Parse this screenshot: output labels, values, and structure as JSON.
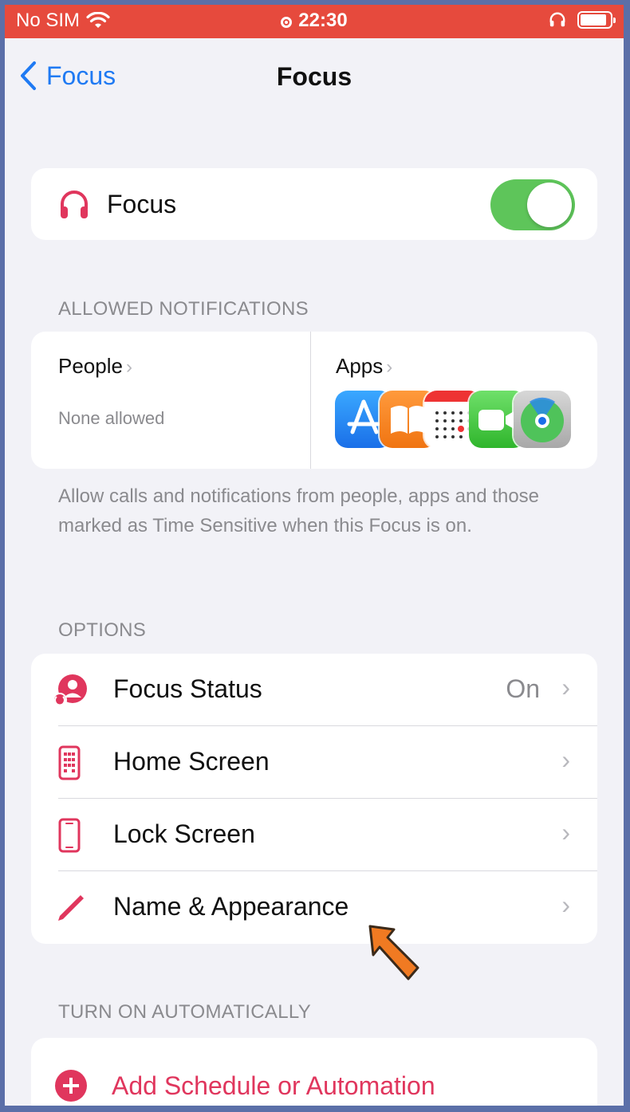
{
  "status_bar": {
    "carrier": "No SIM",
    "time": "22:30",
    "bar_color": "#e64a3d"
  },
  "nav": {
    "back_label": "Focus",
    "title": "Focus"
  },
  "focus_toggle": {
    "label": "Focus",
    "icon": "headphones-icon",
    "state": "on"
  },
  "allowed_notifications": {
    "header": "ALLOWED NOTIFICATIONS",
    "people_title": "People",
    "people_sub": "None allowed",
    "apps_title": "Apps",
    "apps": [
      "app-store-icon",
      "books-icon",
      "calendar-icon",
      "facetime-icon",
      "find-my-icon"
    ]
  },
  "description": "Allow calls and notifications from people, apps and those marked as Time Sensitive when this Focus is on.",
  "options": {
    "header": "OPTIONS",
    "rows": [
      {
        "label": "Focus Status",
        "value": "On",
        "icon": "focus-status-icon"
      },
      {
        "label": "Home Screen",
        "value": "",
        "icon": "home-screen-icon"
      },
      {
        "label": "Lock Screen",
        "value": "",
        "icon": "lock-screen-icon"
      },
      {
        "label": "Name & Appearance",
        "value": "",
        "icon": "pencil-icon"
      }
    ]
  },
  "automation": {
    "header": "TURN ON AUTOMATICALLY",
    "add_label": "Add Schedule or Automation"
  },
  "colors": {
    "accent_blue": "#1f7af3",
    "pink": "#e0365d",
    "toggle_green": "#5ec55a",
    "pointer_arrow": "#f07a22"
  }
}
